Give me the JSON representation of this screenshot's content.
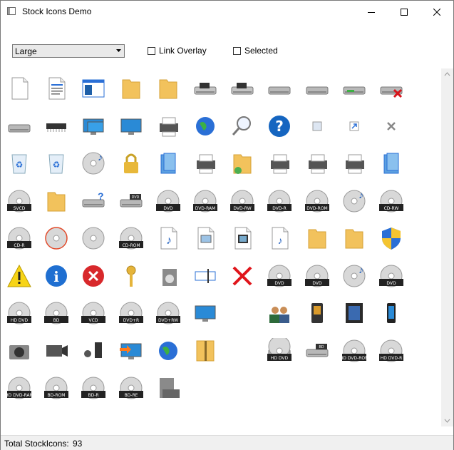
{
  "window": {
    "title": "Stock Icons Demo"
  },
  "controls": {
    "size_combo": {
      "value": "Large"
    },
    "link_overlay": {
      "label": "Link Overlay",
      "checked": false
    },
    "selected": {
      "label": "Selected",
      "checked": false
    }
  },
  "icons": [
    "document-blank",
    "document-text",
    "application",
    "folder",
    "folder-open",
    "floppy-525",
    "floppy-35",
    "removable-drive",
    "hard-drive",
    "network-drive",
    "disconnected-network-drive",
    "cd-drive",
    "ram-chip",
    "network",
    "desktop-computer",
    "printer",
    "globe-world",
    "search",
    "help",
    "small-overlay",
    "shortcut-arrow",
    "delete-x",
    "recycle-bin-empty",
    "recycle-bin-full",
    "audio-cd",
    "lock",
    "auto-list",
    "printer-net",
    "folder-share",
    "printer-fax",
    "printer-fax-net",
    "printer-file",
    "stack",
    "svcd",
    "media-folder",
    "drive-unknown",
    "dvd-drive",
    "dvd",
    "dvd-ram",
    "dvd-rw",
    "dvd-r",
    "dvd-rom",
    "audio-plus",
    "cd-rw",
    "cd-r",
    "cd-burn",
    "blank-cd",
    "cd-rom",
    "audio-file",
    "image-file",
    "video-file",
    "mixed-media",
    "folder-back",
    "folder-front",
    "shield",
    "warning",
    "info",
    "error",
    "key",
    "software",
    "rename",
    "delete-red",
    "media-dvd",
    "media-dvd-2",
    "media-cd-audio",
    "media-dvd-3",
    "hd-dvd",
    "bd",
    "vcd",
    "dvd-plus-r",
    "dvd-plus-rw",
    "desktop-pc",
    "blank",
    "users",
    "media-player",
    "smart-media",
    "mobile-phone",
    "camera",
    "video-camera",
    "audio-player",
    "network-connect",
    "internet",
    "zip-file",
    "blank",
    "hd-dvd-drive",
    "bd-drive",
    "hd-dvd-rom",
    "hd-dvd-r",
    "hd-dvd-ram",
    "bd-rom",
    "bd-r",
    "bd-re",
    "cluster-server"
  ],
  "status": {
    "label": "Total StockIcons:",
    "value": "93"
  }
}
